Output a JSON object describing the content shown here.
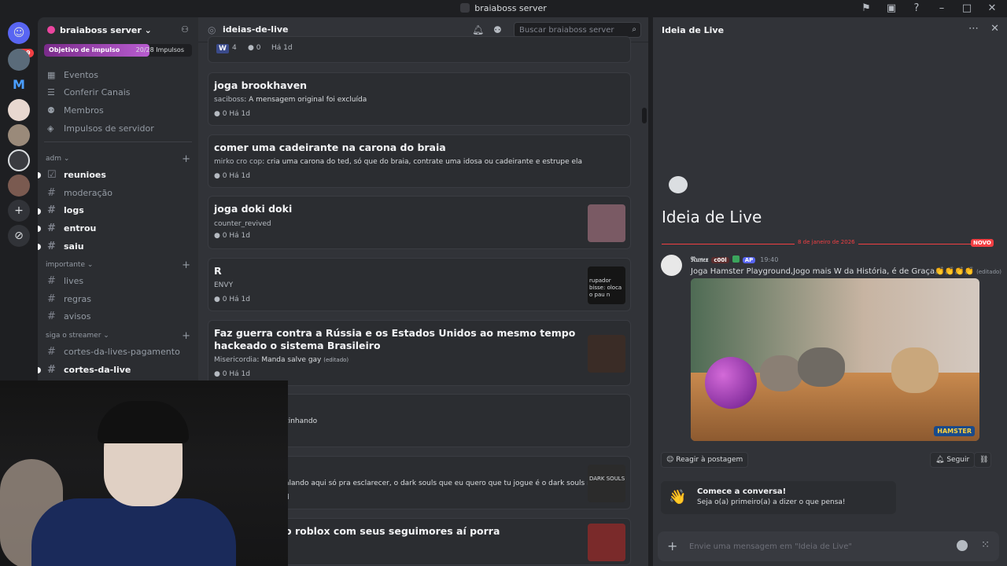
{
  "window": {
    "title": "braiaboss server"
  },
  "guilds": {
    "badge": "319"
  },
  "server": {
    "name": "braiaboss server",
    "boost_label": "Objetivo de impulso",
    "boost_count": "20/28 Impulsos",
    "boost_fraction": 0.714
  },
  "nav": [
    {
      "label": "Eventos",
      "icon": "calendar-icon"
    },
    {
      "label": "Conferir Canais",
      "icon": "browse-icon"
    },
    {
      "label": "Membros",
      "icon": "members-icon"
    },
    {
      "label": "Impulsos de servidor",
      "icon": "boost-icon"
    }
  ],
  "categories": [
    {
      "name": "adm",
      "channels": [
        {
          "name": "reunioes",
          "unread": true,
          "icon": "checklist-icon"
        },
        {
          "name": "moderação",
          "unread": false
        },
        {
          "name": "logs",
          "unread": true
        },
        {
          "name": "entrou",
          "unread": true
        },
        {
          "name": "saiu",
          "unread": true
        }
      ]
    },
    {
      "name": "importante",
      "channels": [
        {
          "name": "lives",
          "unread": false
        },
        {
          "name": "regras",
          "unread": false
        },
        {
          "name": "avisos",
          "unread": false
        }
      ]
    },
    {
      "name": "siga o streamer",
      "channels": [
        {
          "name": "cortes-da-lives-pagamento",
          "unread": false
        },
        {
          "name": "cortes-da-live",
          "unread": true
        }
      ]
    }
  ],
  "forum": {
    "name": "ideias-de-live",
    "search_placeholder": "Buscar braiaboss server",
    "top_card": {
      "reaction": "W",
      "reaction_count": "4",
      "comments": "0",
      "time": "Há 1d"
    },
    "posts": [
      {
        "title": "joga brookhaven",
        "author": "saciboss",
        "text": ": A mensagem original foi excluída",
        "comments": "0",
        "time": "Há 1d",
        "thumb": false
      },
      {
        "title": "comer uma cadeirante na carona do braia",
        "author": "mirko cro cop",
        "text": ": cria uma carona do ted, só que do braia, contrate uma idosa ou cadeirante e estrupe ela",
        "comments": "0",
        "time": "Há 1d",
        "thumb": false
      },
      {
        "title": "joga doki doki",
        "author": "counter_revived",
        "text": "",
        "comments": "0",
        "time": "Há 1d",
        "thumb": true,
        "thumb_color": "#7a5a64"
      },
      {
        "title": "R",
        "author": "ENVY",
        "text": "",
        "comments": "0",
        "time": "Há 1d",
        "thumb": true,
        "thumb_color": "#151515",
        "thumb_text": "rupador bisse: oloca o pau n"
      },
      {
        "title": "Faz guerra contra a Rússia e os Estados Unidos ao mesmo tempo hackeado o sistema Brasileiro",
        "author": "Misericordia",
        "text": ": Manda salve gay",
        "edited": "(editado)",
        "comments": "0",
        "time": "Há 1d",
        "thumb": true,
        "thumb_color": "#3a2c26"
      },
      {
        "title": "",
        "author": "",
        "text": "zinhando",
        "comments": "",
        "time": "",
        "thumb": false
      },
      {
        "title": "",
        "author": "",
        "text": "alando aqui só pra esclarecer, o dark souls que eu quero que tu jogue é o dark souls remaste...",
        "comments": "",
        "time": "d",
        "thumb": true,
        "thumb_color": "#2b2b2b",
        "thumb_text": "DARK SOULS"
      },
      {
        "title": "o roblox com seus seguimores aí porra",
        "author": "",
        "text": "",
        "comments": "",
        "time": "",
        "thumb": true,
        "thumb_color": "#7a2a2a"
      }
    ]
  },
  "thread": {
    "header": "Ideia de Live",
    "title": "Ideia de Live",
    "date_divider": "8 de janeiro de 2026",
    "new_label": "NOVO",
    "author": "𝔑𝔲𝔫𝔢𝔵",
    "author_tag": "c00l",
    "role_tag": "AP",
    "time": "19:40",
    "message": "Joga Hamster Playground,Jogo mais W da História, é de Graça👏👏👏👏",
    "edited": "(editado)",
    "embed_logo": "HAMSTER",
    "react_label": "Reagir à postagem",
    "follow_label": "Seguir",
    "tip_title": "Comece a conversa!",
    "tip_text": "Seja o(a) primeiro(a) a dizer o que pensa!",
    "composer_placeholder": "Envie uma mensagem em \"Ideia de Live\""
  },
  "colors": {
    "accent": "#5865f2",
    "danger": "#f23f43",
    "bg": "#313338",
    "sidebar": "#2b2d31"
  }
}
